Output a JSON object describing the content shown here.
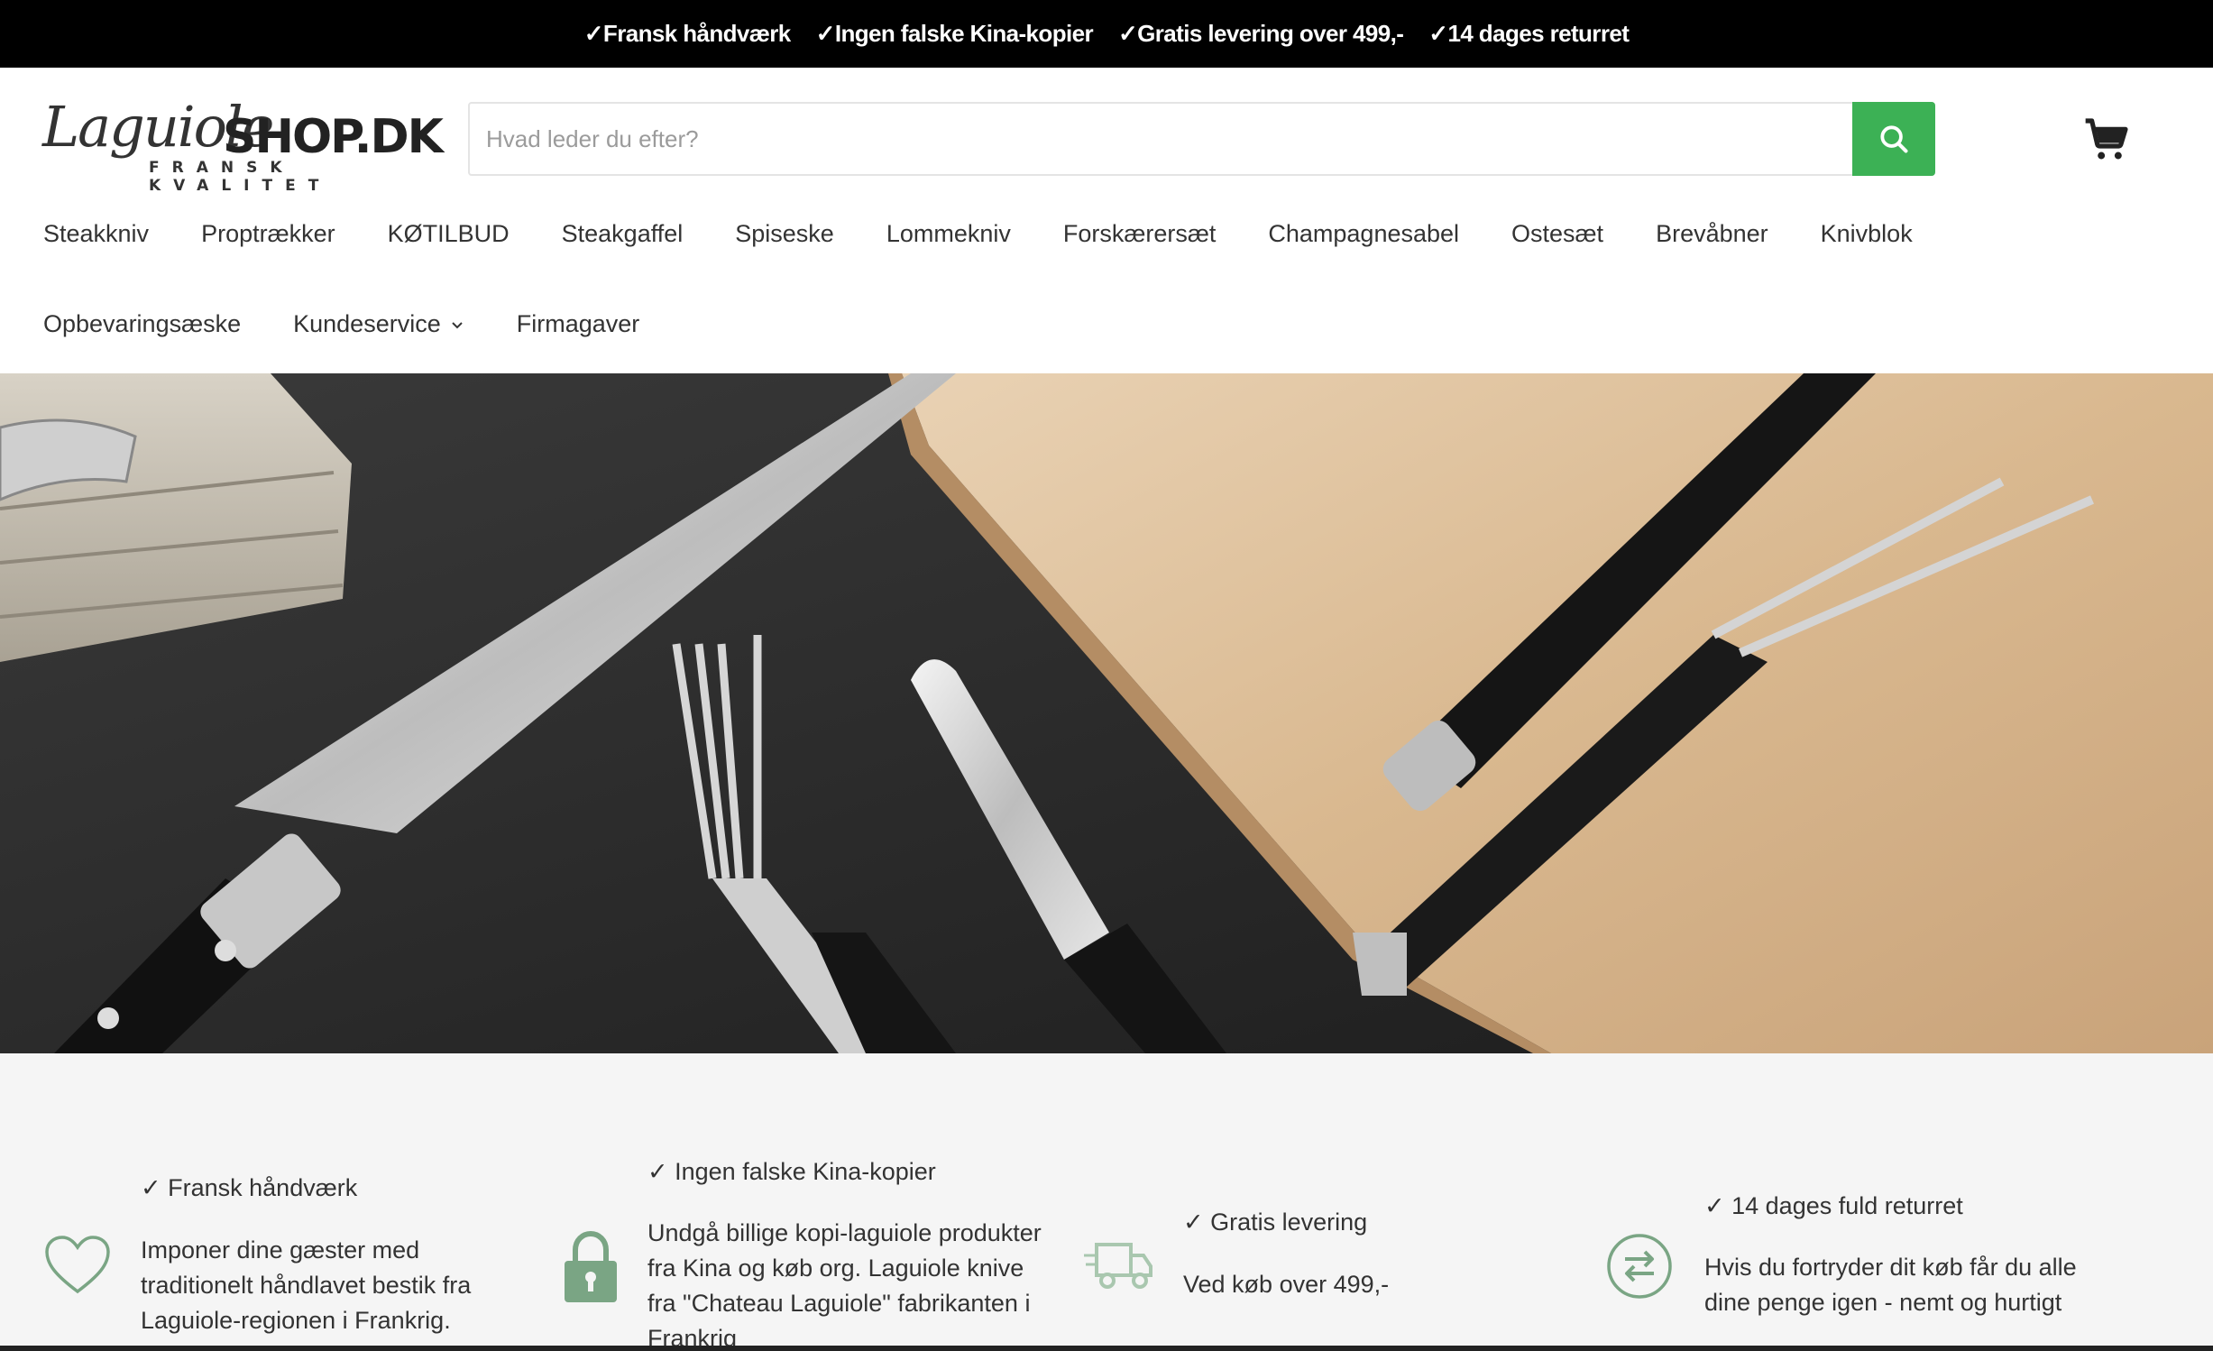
{
  "announcement": {
    "items": [
      "✓Fransk håndværk",
      "✓Ingen falske Kina-kopier",
      "✓Gratis levering over 499,-",
      "✓14 dages returret"
    ]
  },
  "header": {
    "logo": {
      "script": "Laguiole",
      "brand": "SHOP.DK",
      "tagline": "FRANSK KVALITET"
    },
    "search": {
      "placeholder": "Hvad leder du efter?",
      "value": ""
    },
    "icons": {
      "search": "search-icon",
      "cart": "cart-icon"
    },
    "accent_color": "#3cb155"
  },
  "nav": {
    "row1": [
      "Steakkniv",
      "Proptrækker",
      "KØTILBUD",
      "Steakgaffel",
      "Spiseske",
      "Lommekniv",
      "Forskærersæt",
      "Champagnesabel",
      "Ostesæt",
      "Brevåbner",
      "Knivblok"
    ],
    "row2": [
      "Opbevaringsæske",
      "Kundeservice",
      "Firmagaver"
    ]
  },
  "features": [
    {
      "icon": "heart-icon",
      "title": "✓ Fransk håndværk",
      "lines": [
        "Imponer dine gæster med",
        "traditionelt håndlavet bestik fra",
        "Laguiole-regionen i Frankrig."
      ]
    },
    {
      "icon": "lock-icon",
      "title": "✓ Ingen falske Kina-kopier",
      "lines": [
        "Undgå billige kopi-laguiole produkter",
        "fra Kina og køb org. Laguiole knive",
        "fra \"Chateau Laguiole\" fabrikanten i",
        "Frankrig"
      ]
    },
    {
      "icon": "truck-icon",
      "title": "✓ Gratis levering",
      "lines": [
        "Ved køb over 499,-"
      ]
    },
    {
      "icon": "exchange-icon",
      "title": "✓ 14 dages fuld returret",
      "lines": [
        "Hvis du fortryder dit køb får du alle",
        "dine penge igen - nemt og hurtigt"
      ]
    }
  ]
}
